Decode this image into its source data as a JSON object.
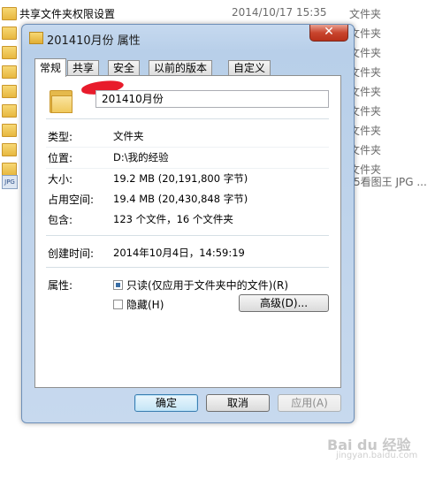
{
  "background": {
    "top_row": {
      "name": "共享文件夹权限设置",
      "date": "2014/10/17 15:35",
      "type": "文件夹"
    },
    "side_types": [
      "文件夹",
      "文件夹",
      "文件夹",
      "文件夹",
      "文件夹",
      "文件夹",
      "文件夹",
      "文件夹"
    ],
    "jpg_row": {
      "icon": "JPG",
      "text": "5看图王 JPG ..."
    }
  },
  "dialog": {
    "title": "201410月份 属性",
    "close_glyph": "✕",
    "tabs": [
      "常规",
      "共享",
      "安全",
      "以前的版本",
      "自定义"
    ],
    "folder_name": "201410月份",
    "properties": {
      "type_label": "类型:",
      "type_value": "文件夹",
      "location_label": "位置:",
      "location_value": "D:\\我的经验",
      "size_label": "大小:",
      "size_value": "19.2 MB (20,191,800 字节)",
      "disk_label": "占用空间:",
      "disk_value": "19.4 MB (20,430,848 字节)",
      "contains_label": "包含:",
      "contains_value": "123 个文件，16 个文件夹",
      "created_label": "创建时间:",
      "created_value": "2014年10月4日，14:59:19",
      "attributes_label": "属性:",
      "readonly_label": "只读(仅应用于文件夹中的文件)(R)",
      "hidden_label": "隐藏(H)",
      "advanced_label": "高级(D)..."
    },
    "buttons": {
      "ok": "确定",
      "cancel": "取消",
      "apply": "应用(A)"
    }
  },
  "watermark": {
    "brand": "Bai du 经验",
    "url": "jingyan.baidu.com"
  }
}
